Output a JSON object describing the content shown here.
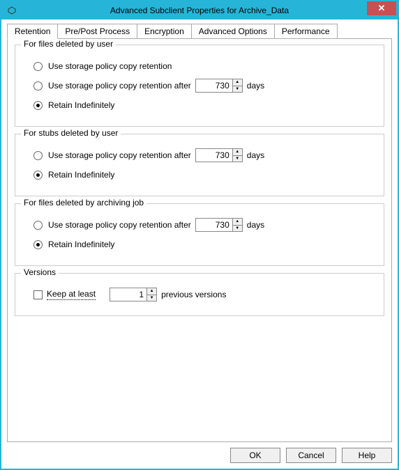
{
  "window": {
    "title": "Advanced Subclient Properties for Archive_Data"
  },
  "tabs": {
    "retention": "Retention",
    "prepost": "Pre/Post Process",
    "encryption": "Encryption",
    "advanced": "Advanced Options",
    "performance": "Performance"
  },
  "groups": {
    "files_deleted_user": {
      "title": "For files deleted by user",
      "opt1": "Use storage policy copy retention",
      "opt2": "Use storage policy copy retention after",
      "opt2_value": "730",
      "opt2_unit": "days",
      "opt3": "Retain Indefinitely"
    },
    "stubs_deleted_user": {
      "title": "For stubs deleted by user",
      "opt1": "Use storage policy copy retention after",
      "opt1_value": "730",
      "opt1_unit": "days",
      "opt2": "Retain Indefinitely"
    },
    "files_deleted_job": {
      "title": "For files deleted by archiving job",
      "opt1": "Use storage policy copy retention after",
      "opt1_value": "730",
      "opt1_unit": "days",
      "opt2": "Retain Indefinitely"
    },
    "versions": {
      "title": "Versions",
      "keep_label": "Keep at least",
      "keep_value": "1",
      "keep_unit": "previous versions"
    }
  },
  "buttons": {
    "ok": "OK",
    "cancel": "Cancel",
    "help": "Help"
  }
}
